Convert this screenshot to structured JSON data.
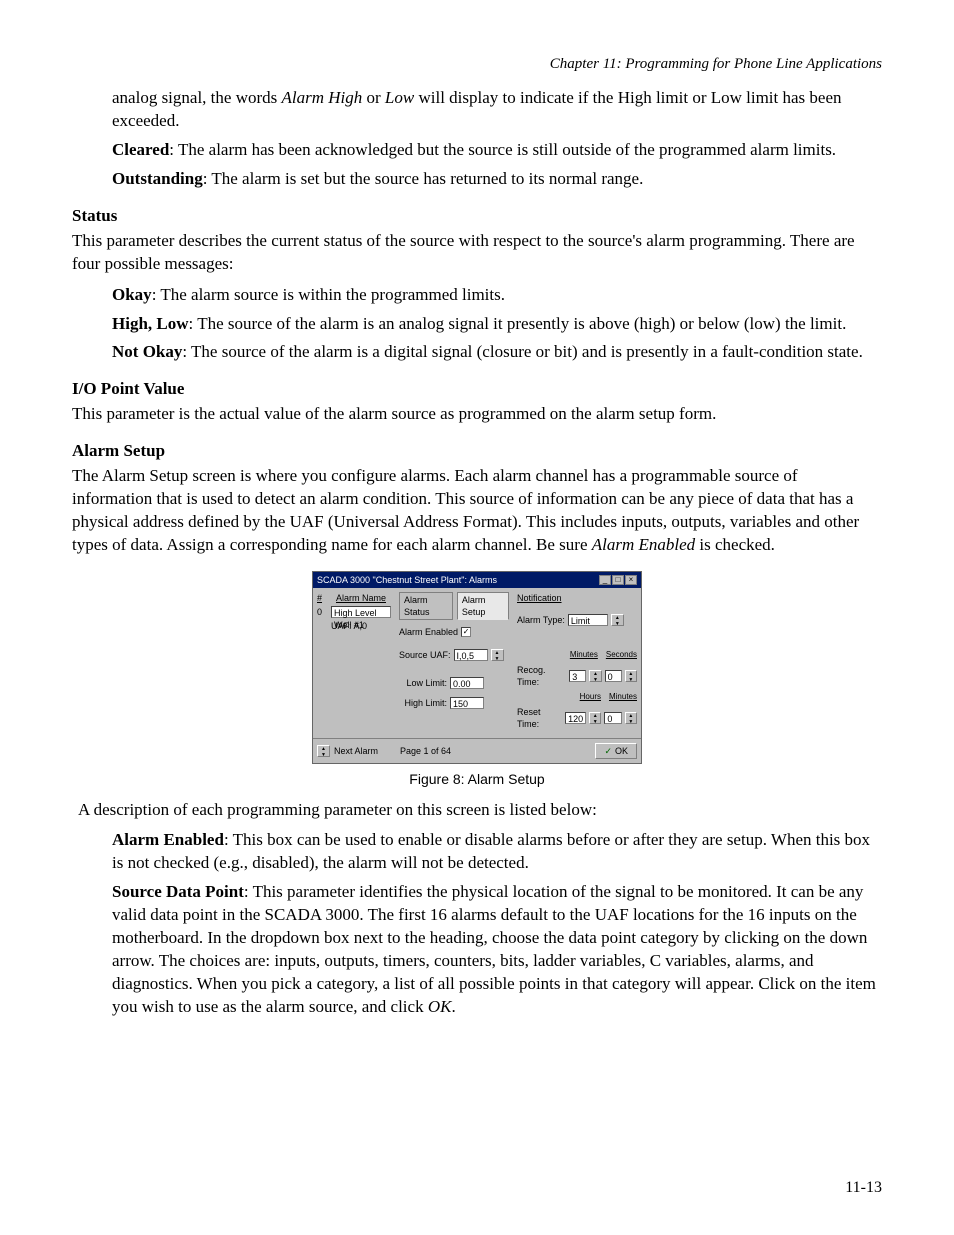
{
  "running_head": "Chapter 11: Programming for Phone Line Applications",
  "intro": {
    "line1_pre": "analog signal, the words ",
    "line1_em1": "Alarm High",
    "line1_mid": " or ",
    "line1_em2": "Low",
    "line1_post": " will display to indicate if the High limit or Low limit has been exceeded."
  },
  "cleared": {
    "term": "Cleared",
    "text": ": The alarm has been acknowledged but the source is still outside of the programmed alarm limits."
  },
  "outstanding": {
    "term": "Outstanding",
    "text": ": The alarm is set but the source has returned to its normal range."
  },
  "status_head": "Status",
  "status_text": "This parameter describes the current status of the source with respect to the source's alarm programming.  There are four possible messages:",
  "okay": {
    "term": "Okay",
    "text": ": The alarm source is within the programmed limits."
  },
  "highlow": {
    "term": "High, Low",
    "text": ": The source of the alarm is an analog signal it presently is above (high) or below (low) the limit."
  },
  "notokay": {
    "term": "Not Okay",
    "text": ": The source of the alarm is a digital signal (closure or bit) and is presently in a fault-condition state."
  },
  "io_head": "I/O Point Value",
  "io_text": "This parameter is the actual value of the alarm source as programmed on the alarm setup form.",
  "alarm_head": "Alarm Setup",
  "alarm_text_pre": "The Alarm Setup screen is where you configure alarms.  Each alarm channel has a programmable source of information that is used to detect an alarm condition.  This source of information can be any piece of data that has a physical address defined by the UAF (Universal Address Format).  This includes inputs, outputs, variables and other types of data. Assign a corresponding name for each alarm channel.  Be sure ",
  "alarm_text_em": "Alarm Enabled",
  "alarm_text_post": " is checked.",
  "screenshot": {
    "title": "SCADA 3000 \"Chestnut Street Plant\": Alarms",
    "col_no": "#",
    "col_name": "Alarm Name",
    "row_no": "0",
    "row_name": "High Level Well #1",
    "row_uaf": "UAF: A,0",
    "tab_status": "Alarm Status",
    "tab_setup": "Alarm Setup",
    "alarm_enabled": "Alarm Enabled",
    "source_uaf": "Source UAF:",
    "source_uaf_val": "I,0,5",
    "low_limit": "Low Limit:",
    "low_limit_val": "0.00",
    "high_limit": "High Limit:",
    "high_limit_val": "150",
    "notification": "Notification",
    "alarm_type": "Alarm Type:",
    "alarm_type_val": "Limit",
    "minutes_hdr": "Minutes",
    "seconds_hdr": "Seconds",
    "recog": "Recog. Time:",
    "recog_min": "3",
    "recog_sec": "0",
    "hours_hdr": "Hours",
    "minutes_hdr2": "Minutes",
    "reset": "Reset Time:",
    "reset_h": "120",
    "reset_m": "0",
    "next": "Next Alarm",
    "page": "Page 1 of 64",
    "ok": "OK"
  },
  "caption": "Figure 8: Alarm Setup",
  "desc_intro": "A description of each programming parameter on this screen is listed below:",
  "enabled": {
    "term": "Alarm Enabled",
    "text": ": This box can be used to enable or disable alarms before or after they are setup.  When this box is not checked (e.g., disabled), the alarm will not be detected."
  },
  "sdp": {
    "term": "Source Data Point",
    "text_pre": ": This parameter identifies the physical location of the signal to be monitored.  It can be any valid data point in the SCADA 3000.  The first 16 alarms default to the UAF locations for the 16 inputs on the motherboard.  In the dropdown box next to the heading, choose the data point category by clicking on the down arrow. The choices are: inputs, outputs, timers, counters, bits, ladder variables, C variables, alarms, and diagnostics. When you pick a category, a list of all possible points in that category will appear. Click on the item you wish to use as the alarm source, and click ",
    "text_em": "OK",
    "text_post": "."
  },
  "page_num": "11-13"
}
